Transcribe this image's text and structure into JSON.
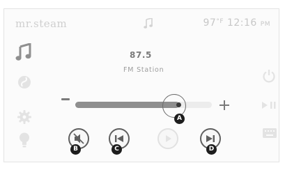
{
  "header": {
    "brand": "mr.steam",
    "temperature": "97",
    "temperature_unit": "°F",
    "time": "12:16",
    "time_period": "PM"
  },
  "player": {
    "frequency": "87.5",
    "source": "FM Station",
    "volume_level": 0.76
  },
  "callouts": {
    "a": "A",
    "b": "B",
    "c": "C",
    "d": "D"
  },
  "icons": {
    "top_center": "music-note-icon",
    "sidebar": [
      "music-icon",
      "steam-icon",
      "settings-gear-icon",
      "light-bulb-icon"
    ],
    "controls": [
      "mute-icon",
      "previous-icon",
      "play-icon",
      "next-icon"
    ],
    "right": [
      "power-icon",
      "play-pause-icon",
      "keyboard-icon"
    ]
  },
  "colors": {
    "active_icon": "#8f8f8f",
    "inactive_icon": "#e3e3e3",
    "slider_fill": "#8f8f8f",
    "callout_badge": "#1d1d1d"
  }
}
